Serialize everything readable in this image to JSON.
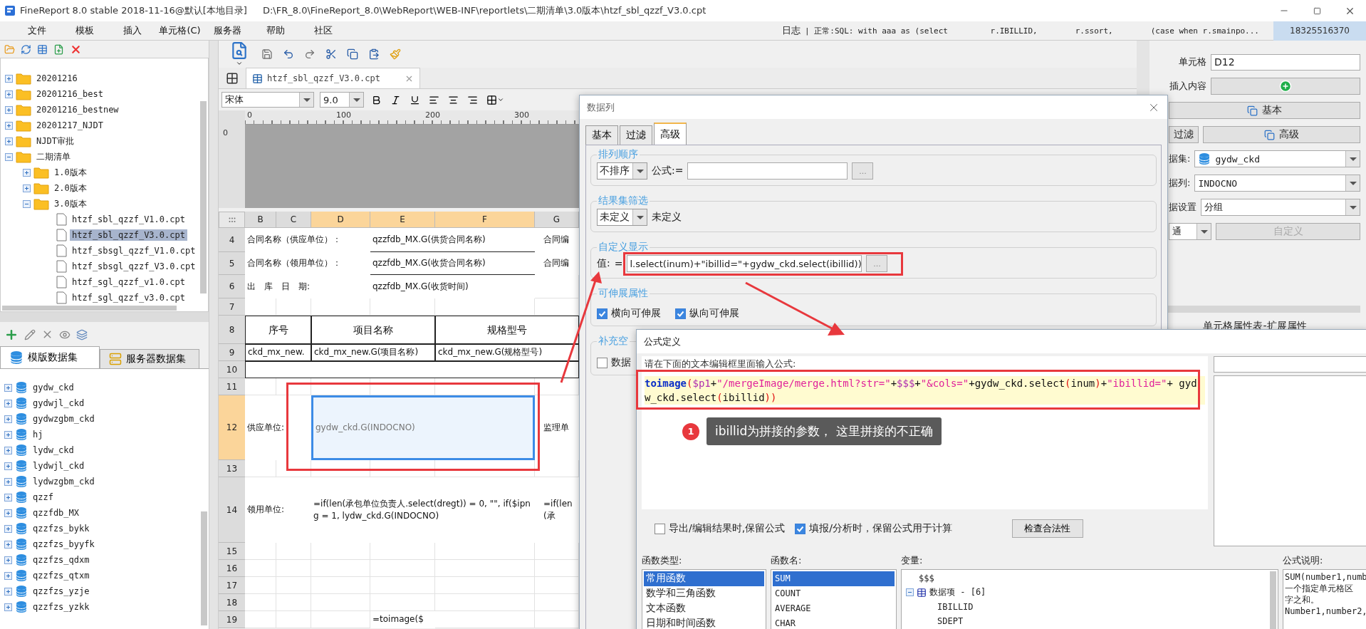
{
  "window": {
    "title": "FineReport 8.0 stable 2018-11-16@默认[本地目录]",
    "path": "D:\\FR_8.0\\FineReport_8.0\\WebReport\\WEB-INF\\reportlets\\二期清单\\3.0版本\\htzf_sbl_qzzf_V3.0.cpt"
  },
  "menu": [
    "文件",
    "模板",
    "插入",
    "单元格(C)",
    "服务器",
    "帮助",
    "社区"
  ],
  "log": {
    "label": "日志",
    "message": "| 正常:SQL: with aaa as (select         r.IBILLID,        r.ssort,        (case when r.smainpo...",
    "user": "18325516370"
  },
  "file_tree": [
    {
      "label": "20201216",
      "kind": "folder",
      "expanded": false,
      "selected": false
    },
    {
      "label": "20201216_best",
      "kind": "folder",
      "expanded": false,
      "selected": false
    },
    {
      "label": "20201216_bestnew",
      "kind": "folder",
      "expanded": false,
      "selected": false
    },
    {
      "label": "20201217_NJDT",
      "kind": "folder",
      "expanded": false,
      "selected": false
    },
    {
      "label": "NJDT审批",
      "kind": "folder",
      "expanded": false,
      "selected": false
    },
    {
      "label": "二期清单",
      "kind": "folder",
      "expanded": true,
      "selected": false,
      "children": [
        {
          "label": "1.0版本",
          "kind": "folder",
          "expanded": false,
          "selected": false
        },
        {
          "label": "2.0版本",
          "kind": "folder",
          "expanded": false,
          "selected": false
        },
        {
          "label": "3.0版本",
          "kind": "folder",
          "expanded": true,
          "selected": false,
          "children": [
            {
              "label": "htzf_sbl_qzzf_V1.0.cpt",
              "kind": "file",
              "selected": false
            },
            {
              "label": "htzf_sbl_qzzf_V3.0.cpt",
              "kind": "file",
              "selected": true
            },
            {
              "label": "htzf_sbsgl_qzzf_V1.0.cpt",
              "kind": "file",
              "selected": false
            },
            {
              "label": "htzf_sbsgl_qzzf_V3.0.cpt",
              "kind": "file",
              "selected": false
            },
            {
              "label": "htzf_sgl_qzzf_v1.0.cpt",
              "kind": "file",
              "selected": false
            },
            {
              "label": "htzf_sgl_qzzf_v3.0.cpt",
              "kind": "file",
              "selected": false
            }
          ]
        }
      ]
    }
  ],
  "dataset_tabs": [
    {
      "label": "模版数据集",
      "selected": true
    },
    {
      "label": "服务器数据集",
      "selected": false
    }
  ],
  "datasets": [
    "gydw_ckd",
    "gydwjl_ckd",
    "gydwzgbm_ckd",
    "hj",
    "lydw_ckd",
    "lydwjl_ckd",
    "lydwzgbm_ckd",
    "qzzf",
    "qzzfdb_MX",
    "qzzfzs_bykk",
    "qzzfzs_byyfk",
    "qzzfzs_qdxm",
    "qzzfzs_qtxm",
    "qzzfzs_yzje",
    "qzzfzs_yzkk"
  ],
  "editor_tab": {
    "label": "htzf_sbl_qzzf_V3.0.cpt"
  },
  "format_bar": {
    "font": "宋体",
    "size": "9.0"
  },
  "ruler": {
    "marks": [
      "0",
      "100",
      "200",
      "300"
    ],
    "side_mark": "0"
  },
  "grid": {
    "columns": [
      {
        "label": "B",
        "selected": false
      },
      {
        "label": "C",
        "selected": false
      },
      {
        "label": "D",
        "selected": true
      },
      {
        "label": "E",
        "selected": true
      },
      {
        "label": "F",
        "selected": true
      },
      {
        "label": "G",
        "selected": false
      }
    ],
    "rows": [
      {
        "number": "4",
        "selected": false,
        "cells": [
          {
            "kind": "label",
            "text": "合同名称（供应单位）："
          },
          {
            "kind": "underlined",
            "text": "qzzfdb_MX.G(供货合同名称)"
          },
          {
            "kind": "label",
            "text": "合同编"
          }
        ]
      },
      {
        "number": "5",
        "selected": false,
        "cells": [
          {
            "kind": "label",
            "text": "合同名称（领用单位）："
          },
          {
            "kind": "underlined",
            "text": "qzzfdb_MX.G(收货合同名称)"
          },
          {
            "kind": "label",
            "text": "合同编"
          }
        ]
      },
      {
        "number": "6",
        "selected": false,
        "cells": [
          {
            "kind": "label",
            "text": "出　库　日　期:"
          },
          {
            "kind": "label",
            "text": "qzzfdb_MX.G(收货时间)"
          }
        ]
      },
      {
        "number": "7",
        "selected": false,
        "cells": []
      },
      {
        "number": "8",
        "selected": false,
        "cells": [
          {
            "kind": "header",
            "text": "序号"
          },
          {
            "kind": "header",
            "text": "项目名称"
          },
          {
            "kind": "header",
            "text": "规格型号"
          }
        ]
      },
      {
        "number": "9",
        "selected": false,
        "cells": [
          {
            "kind": "boxed",
            "text": "ckd_mx_new."
          },
          {
            "kind": "boxed",
            "text": "ckd_mx_new.G(项目名称)"
          },
          {
            "kind": "boxed",
            "text": "ckd_mx_new.G(规格型号)"
          }
        ]
      },
      {
        "number": "10",
        "selected": false,
        "cells": [
          {
            "kind": "boxed",
            "text": ""
          }
        ]
      },
      {
        "number": "11",
        "selected": false,
        "cells": []
      },
      {
        "number": "12",
        "selected": true,
        "cells": [
          {
            "kind": "label",
            "text": "供应单位:"
          },
          {
            "kind": "selected",
            "text": "gydw_ckd.G(INDOCNO)"
          },
          {
            "kind": "label",
            "text": "监理单"
          }
        ]
      },
      {
        "number": "13",
        "selected": false,
        "cells": []
      },
      {
        "number": "14",
        "selected": false,
        "cells": [
          {
            "kind": "label",
            "text": "领用单位:"
          },
          {
            "kind": "label",
            "text": "=if(len(承包单位负责人.select(dregt)) = 0, \"\", if($ipng = 1, lydw_ckd.G(INDOCNO)"
          },
          {
            "kind": "label",
            "text": "=if(len(承"
          }
        ]
      },
      {
        "number": "15",
        "selected": false,
        "cells": []
      },
      {
        "number": "16",
        "selected": false,
        "cells": []
      },
      {
        "number": "17",
        "selected": false,
        "cells": []
      },
      {
        "number": "18",
        "selected": false,
        "cells": []
      },
      {
        "number": "19",
        "selected": false,
        "cells": [
          {
            "kind": "label",
            "text": ""
          },
          {
            "kind": "label",
            "text": ""
          },
          {
            "kind": "label",
            "text": ""
          },
          {
            "kind": "label",
            "text": "=toimage($"
          }
        ]
      }
    ]
  },
  "cell_panel": {
    "cell_label": "单元格",
    "cell_value": "D12",
    "insert_label": "插入内容",
    "basic_button": "基本",
    "filter_button": "过滤",
    "advanced_button": "高级",
    "dataset_label": "据集:",
    "dataset_value": "gydw_ckd",
    "column_label": "据列:",
    "column_value": "INDOCNO",
    "setting_label": "据设置",
    "setting_value": "分组",
    "mode_value": "通",
    "custom_button": "自定义",
    "custom_disabled": true,
    "section_title": "单元格属性表-扩展属性"
  },
  "data_column_dialog": {
    "title": "数据列",
    "tabs": [
      {
        "label": "基本",
        "selected": false
      },
      {
        "label": "过滤",
        "selected": false
      },
      {
        "label": "高级",
        "selected": true
      }
    ],
    "sort": {
      "legend": "排列顺序",
      "value": "不排序",
      "formula_label": "公式:=",
      "browse": "..."
    },
    "filter": {
      "legend": "结果集筛选",
      "value": "未定义",
      "note": "未定义"
    },
    "custom_display": {
      "legend": "自定义显示",
      "label": "值:",
      "prefix": "=",
      "value": "l.select(inum)+\"ibillid=\"+gydw_ckd.select(ibillid))",
      "browse": "..."
    },
    "expand": {
      "legend": "可伸展属性",
      "options": [
        {
          "label": "横向可伸展",
          "checked": true
        },
        {
          "label": "纵向可伸展",
          "checked": true
        }
      ]
    },
    "fill": {
      "legend": "补充空",
      "option": {
        "label": "数据",
        "checked": false
      }
    }
  },
  "formula_dialog": {
    "title": "公式定义",
    "prompt": "请在下面的文本编辑框里面输入公式:",
    "formula": [
      {
        "kind": "function",
        "text": "toimage"
      },
      {
        "kind": "paren",
        "text": "("
      },
      {
        "kind": "variable",
        "text": "$p1"
      },
      {
        "kind": "plain",
        "text": "+"
      },
      {
        "kind": "string",
        "text": "\"/mergeImage/merge.html?str=\""
      },
      {
        "kind": "plain",
        "text": "+"
      },
      {
        "kind": "variable",
        "text": "$$$"
      },
      {
        "kind": "plain",
        "text": "+"
      },
      {
        "kind": "string",
        "text": "\"&cols=\""
      },
      {
        "kind": "plain",
        "text": "+gydw_ckd.select"
      },
      {
        "kind": "paren",
        "text": "("
      },
      {
        "kind": "plain",
        "text": "inum"
      },
      {
        "kind": "paren",
        "text": ")"
      },
      {
        "kind": "plain",
        "text": "+"
      },
      {
        "kind": "string",
        "text": "\"ibillid=\""
      },
      {
        "kind": "plain",
        "text": "+ gydw_ckd.select"
      },
      {
        "kind": "paren",
        "text": "("
      },
      {
        "kind": "plain",
        "text": "ibillid"
      },
      {
        "kind": "paren",
        "text": "))"
      }
    ],
    "options": [
      {
        "label": "导出/编辑结果时,保留公式",
        "checked": false
      },
      {
        "label": "填报/分析时，保留公式用于计算",
        "checked": true
      }
    ],
    "check_button": "检查合法性",
    "function_types": {
      "label": "函数类型:",
      "items": [
        {
          "label": "常用函数",
          "selected": true
        },
        {
          "label": "数学和三角函数",
          "selected": false
        },
        {
          "label": "文本函数",
          "selected": false
        },
        {
          "label": "日期和时间函数",
          "selected": false
        }
      ]
    },
    "function_names": {
      "label": "函数名:",
      "items": [
        {
          "label": "SUM",
          "selected": true
        },
        {
          "label": "COUNT",
          "selected": false
        },
        {
          "label": "AVERAGE",
          "selected": false
        },
        {
          "label": "CHAR",
          "selected": false
        }
      ]
    },
    "variables": {
      "label": "变量:",
      "items": [
        {
          "label": "$$$"
        },
        {
          "label": "数据项 - [6]",
          "expanded": true,
          "children": [
            {
              "label": "IBILLID"
            },
            {
              "label": "SDEPT"
            }
          ]
        }
      ]
    },
    "description": {
      "label": "公式说明:",
      "lines": [
        "SUM(number1,numb",
        "一个指定单元格区",
        "字之和。",
        "Number1,number2,"
      ]
    }
  },
  "annotation": {
    "number": "1",
    "text": "ibillid为拼接的参数， 这里拼接的不正确"
  }
}
